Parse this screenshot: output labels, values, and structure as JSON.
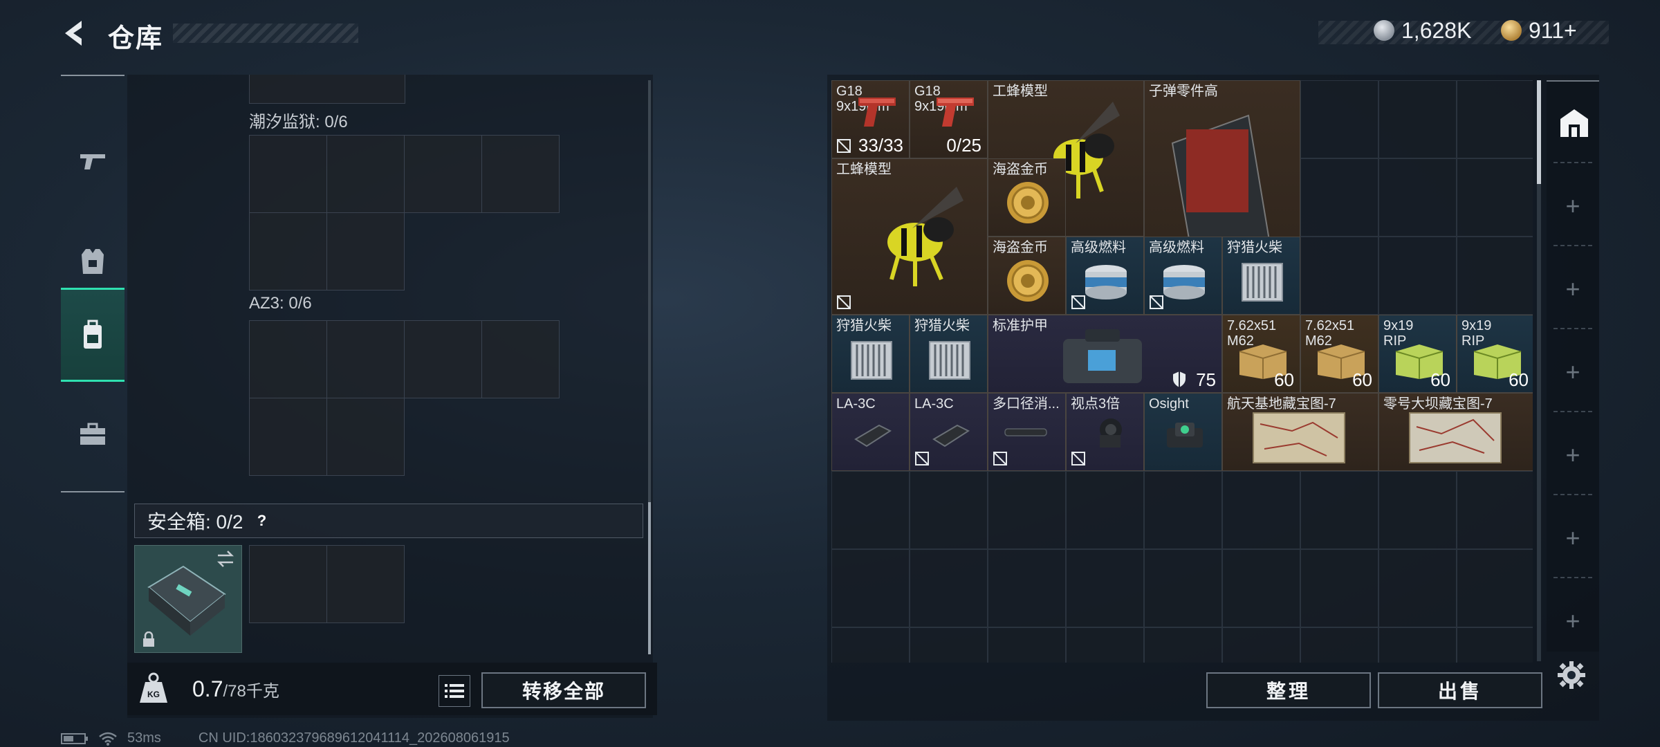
{
  "header": {
    "title": "仓库",
    "currency": [
      {
        "icon": "silver-coin-icon",
        "value": "1,628K"
      },
      {
        "icon": "gold-coin-icon",
        "value": "911+"
      }
    ]
  },
  "side_nav": {
    "items": [
      {
        "icon": "gun-icon",
        "active": false
      },
      {
        "icon": "armor-vest-icon",
        "active": false
      },
      {
        "icon": "backpack-icon",
        "active": true
      },
      {
        "icon": "toolbox-icon",
        "active": false
      }
    ]
  },
  "left_panel": {
    "slots": [
      {
        "label": "潮汐监狱: 0/6"
      },
      {
        "label": "AZ3: 0/6"
      }
    ],
    "safebox": {
      "label": "安全箱: 0/2",
      "help": "?"
    }
  },
  "weight": {
    "current": "0.7",
    "max": "/78千克"
  },
  "transfer_all": "转移全部",
  "status": {
    "ping": "53ms",
    "uid": "CN UID:1860323796896120411​14_202608061915"
  },
  "inventory": {
    "items": [
      {
        "name": "G18\n9x19mm",
        "qty": "33/33",
        "color": "brown"
      },
      {
        "name": "G18\n9x19mm",
        "qty": "0/25",
        "color": "brown"
      },
      {
        "name": "工蜂模型",
        "qty": "",
        "color": "brown"
      },
      {
        "name": "子弹零件高",
        "qty": "",
        "color": "brown"
      },
      {
        "name": "工蜂模型",
        "qty": "",
        "color": "brown"
      },
      {
        "name": "海盗金币",
        "qty": "",
        "color": "brown"
      },
      {
        "name": "海盗金币",
        "qty": "",
        "color": "brown"
      },
      {
        "name": "高级燃料",
        "qty": "",
        "color": "blue"
      },
      {
        "name": "高级燃料",
        "qty": "",
        "color": "blue"
      },
      {
        "name": "狩猎火柴",
        "qty": "",
        "color": "blue"
      },
      {
        "name": "狩猎火柴",
        "qty": "",
        "color": "blue"
      },
      {
        "name": "狩猎火柴",
        "qty": "",
        "color": "blue"
      },
      {
        "name": "标准护甲",
        "qty": "75",
        "color": "purple"
      },
      {
        "name": "7.62x51\nM62",
        "qty": "60",
        "color": "gold"
      },
      {
        "name": "7.62x51\nM62",
        "qty": "60",
        "color": "gold"
      },
      {
        "name": "9x19\nRIP",
        "qty": "60",
        "color": "blue"
      },
      {
        "name": "9x19\nRIP",
        "qty": "60",
        "color": "blue"
      },
      {
        "name": "LA-3C",
        "qty": "",
        "color": "purple"
      },
      {
        "name": "LA-3C",
        "qty": "",
        "color": "purple"
      },
      {
        "name": "多口径消...",
        "qty": "",
        "color": "purple"
      },
      {
        "name": "视点3倍",
        "qty": "",
        "color": "purple"
      },
      {
        "name": "Osight",
        "qty": "",
        "color": "blue"
      },
      {
        "name": "航天基地藏宝图-7",
        "qty": "",
        "color": "brown"
      },
      {
        "name": "零号大坝藏宝图-7",
        "qty": "",
        "color": "brown"
      }
    ]
  },
  "buttons": {
    "sort": "整理",
    "sell": "出售"
  }
}
